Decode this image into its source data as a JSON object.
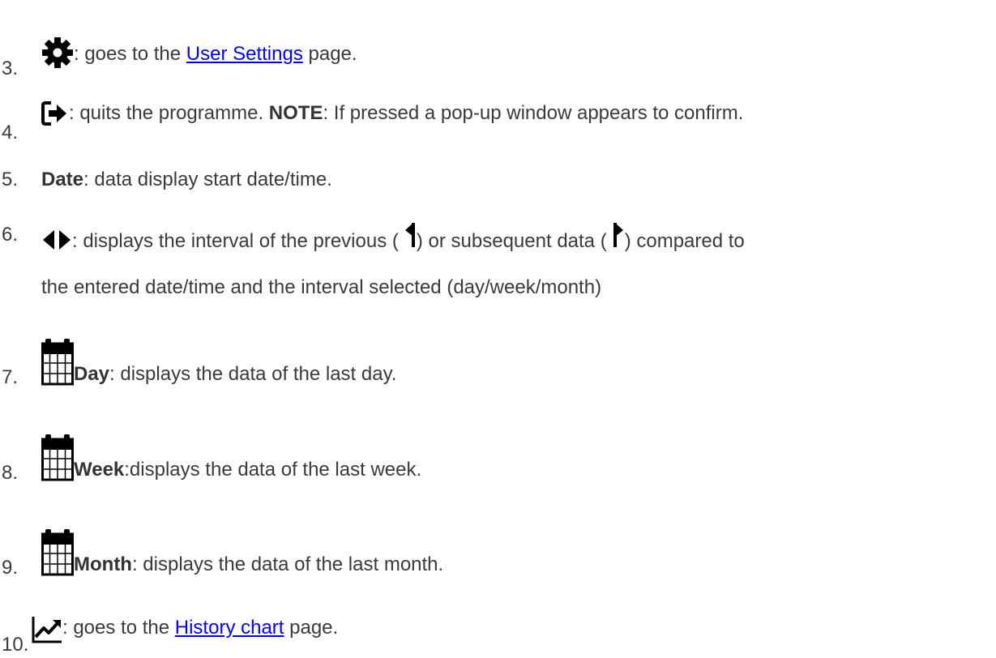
{
  "items": [
    {
      "number": "3.",
      "icon": "gear-icon",
      "text_before": ": goes to the ",
      "link": "User Settings",
      "text_after": " page."
    },
    {
      "number": "4.",
      "icon": "sign-out-icon",
      "text_before": ": quits the programme. ",
      "bold": "NOTE",
      "text_after": ": If pressed a pop-up window appears to confirm."
    },
    {
      "number": "5.",
      "bold": "Date",
      "text_after": ": data display start date/time."
    },
    {
      "number": "6.",
      "icon": "left-right-triangles-icon",
      "text_a": ": displays the interval of the previous (",
      "icon_left": "left-triangle-icon",
      "text_b": ") or subsequent data (",
      "icon_right": "right-triangle-icon",
      "text_c": ") compared to",
      "line2": "the entered date/time and the interval selected (day/week/month)"
    },
    {
      "number": "7.",
      "icon": "calendar-icon",
      "bold": "Day",
      "text_after": ": displays the data of the last day."
    },
    {
      "number": "8.",
      "icon": "calendar-icon",
      "bold": "Week",
      "text_after": ":displays the data of the last week."
    },
    {
      "number": "9.",
      "icon": "calendar-icon",
      "bold": "Month",
      "text_after": ": displays the data of the last month",
      "trailing": "."
    },
    {
      "number": "10.",
      "icon": "line-chart-icon",
      "text_before": ": goes to the ",
      "link": "History chart",
      "text_after": " page."
    }
  ],
  "colors": {
    "text": "#3a3a3a",
    "link": "#0000ee",
    "icon": "#000000"
  }
}
